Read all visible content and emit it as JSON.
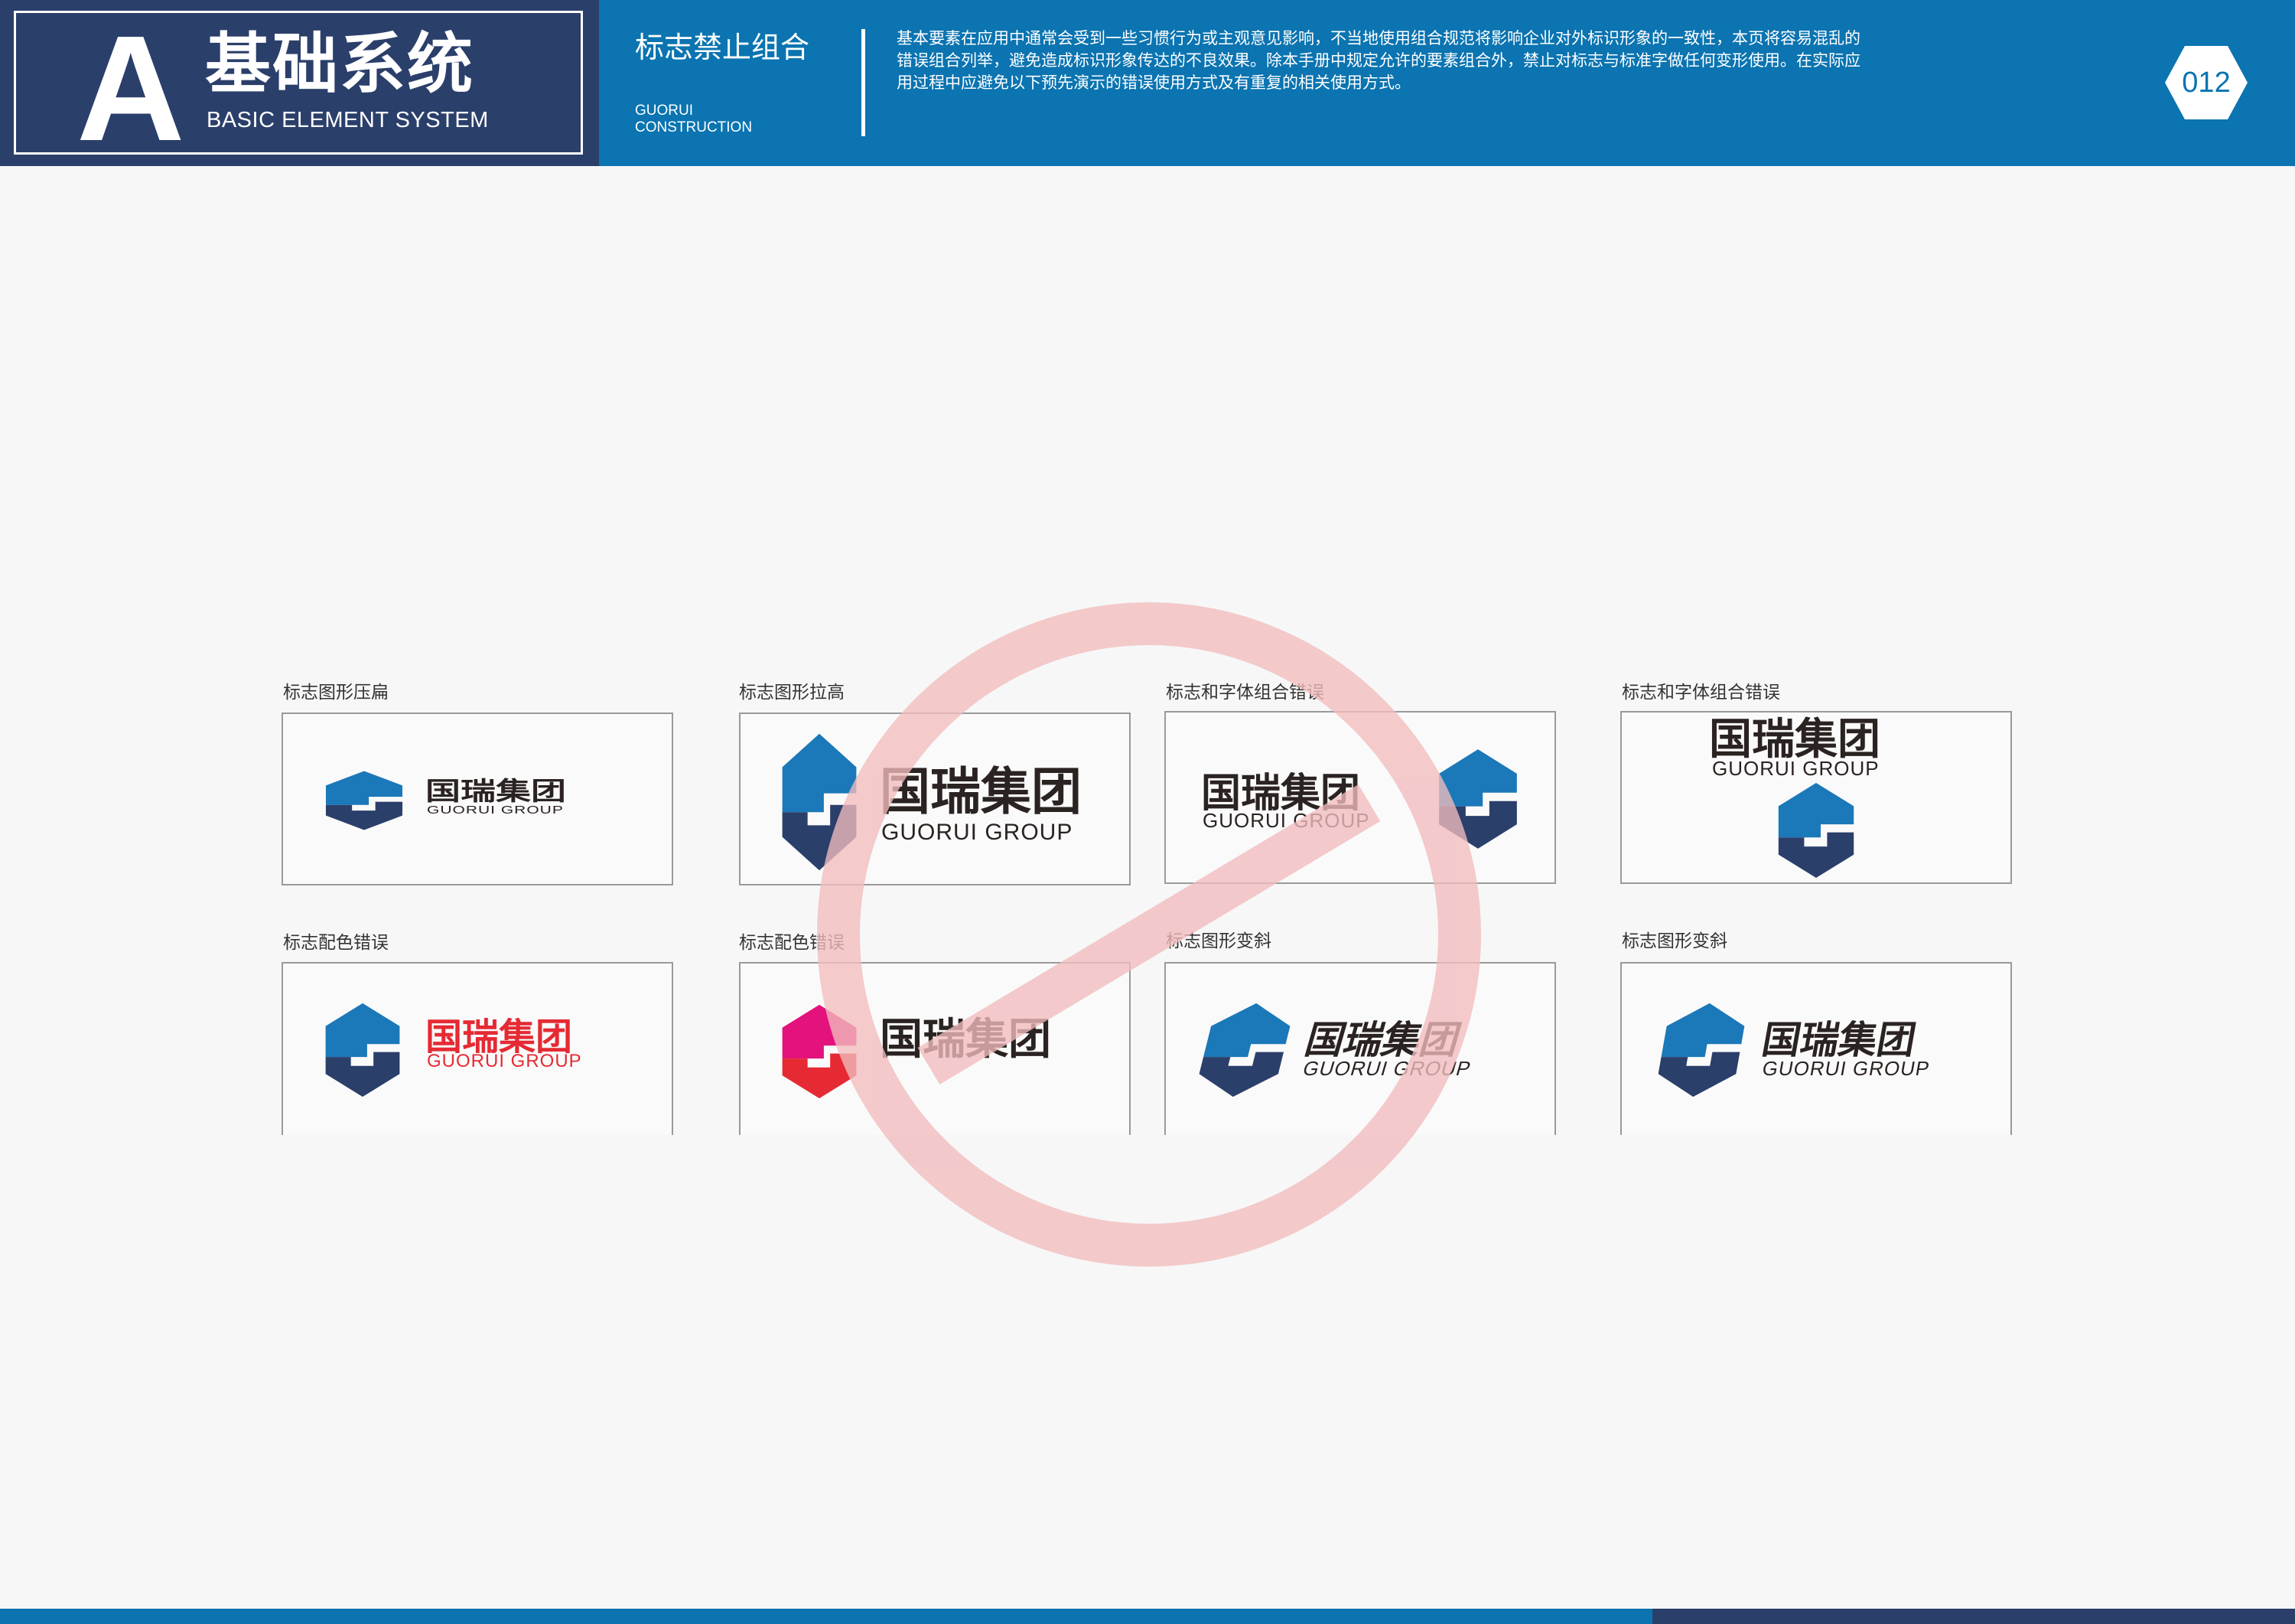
{
  "header": {
    "letter": "A",
    "title": "基础系统",
    "subtitle": "BASIC ELEMENT SYSTEM",
    "section_title": "标志禁止组合",
    "section_en_1": "GUORUI",
    "section_en_2": "CONSTRUCTION",
    "description": "基本要素在应用中通常会受到一些习惯行为或主观意见影响，不当地使用组合规范将影响企业对外标识形象的一致性，本页将容易混乱的错误组合列举，避免造成标识形象传达的不良效果。除本手册中规定允许的要素组合外，禁止对标志与标准字做任何变形使用。在实际应用过程中应避免以下预先演示的错误使用方式及有重复的相关使用方式。",
    "page_number": "012"
  },
  "colors": {
    "navy": "#2b3f6b",
    "blue": "#0b74b1",
    "logo_blue": "#1b78b9",
    "logo_navy": "#2b3f6b",
    "red": "#e52a33",
    "magenta": "#e4127c",
    "text_dark": "#2a2321",
    "prohibit": "#f4c7c8"
  },
  "examples": [
    {
      "label": "标志图形压扁",
      "cn": "国瑞集团",
      "en": "GUORUI GROUP"
    },
    {
      "label": "标志图形拉高",
      "cn": "国瑞集团",
      "en": "GUORUI GROUP"
    },
    {
      "label": "标志和字体组合错误",
      "cn": "国瑞集团",
      "en": "GUORUI GROUP"
    },
    {
      "label": "标志和字体组合错误",
      "cn": "国瑞集团",
      "en": "GUORUI GROUP"
    },
    {
      "label": "标志配色错误",
      "cn": "国瑞集团",
      "en": "GUORUI GROUP"
    },
    {
      "label": "标志配色错误",
      "cn": "国瑞集团"
    },
    {
      "label": "标志图形变斜",
      "cn": "国瑞集团",
      "en": "GUORUI GROUP"
    },
    {
      "label": "标志图形变斜",
      "cn": "国瑞集团",
      "en": "GUORUI GROUP"
    }
  ],
  "icons": {
    "logo": "hexagon-g-logo-icon",
    "prohibition": "prohibition-sign-icon"
  }
}
